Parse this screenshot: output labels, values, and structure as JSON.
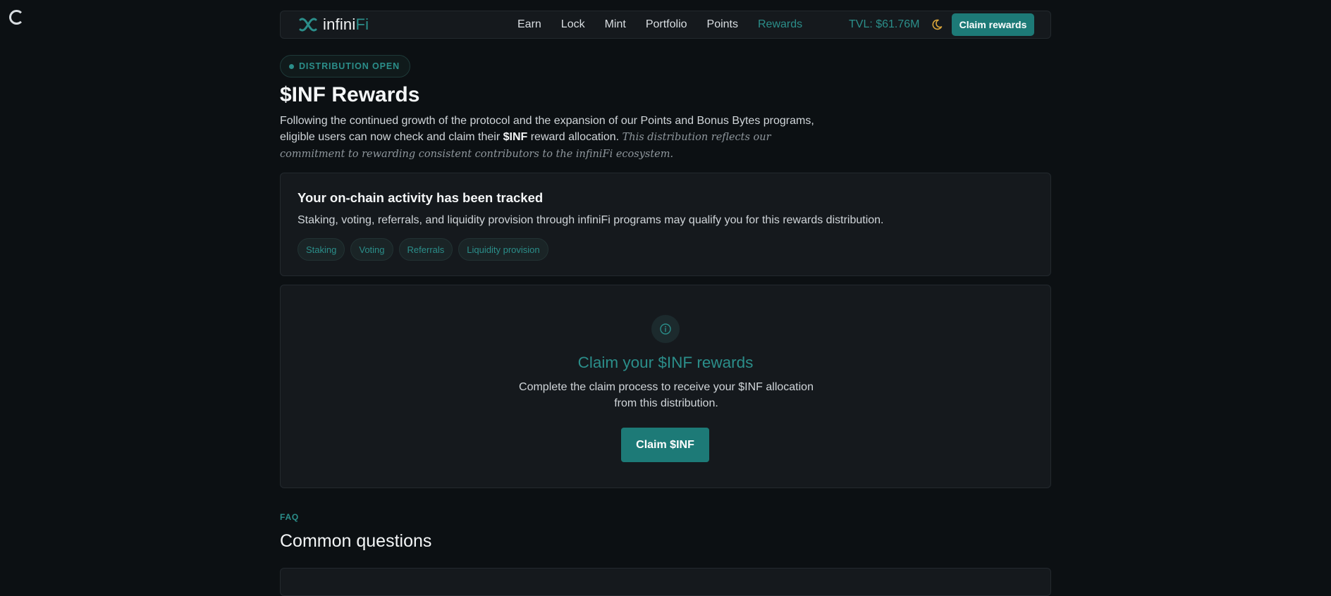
{
  "brand": {
    "name_main": "infini",
    "name_accent": "Fi",
    "accent_color": "#2b8e8a"
  },
  "nav": {
    "links": [
      "Earn",
      "Lock",
      "Mint",
      "Portfolio",
      "Points",
      "Rewards"
    ],
    "active": "Rewards",
    "tvl": "TVL: $61.76M",
    "theme_icon": "moon-icon",
    "claim_button": "Claim rewards"
  },
  "hero": {
    "badge": "DISTRIBUTION OPEN",
    "title": "$INF Rewards",
    "intro_part1": "Following the continued growth of the protocol and the expansion of our Points and Bonus Bytes programs, eligible users can now check and claim their ",
    "intro_bold": "$INF",
    "intro_part2": " reward allocation. ",
    "intro_italic": "This distribution reflects our commitment to rewarding consistent contributors to the infiniFi ecosystem."
  },
  "activity": {
    "title": "Your on-chain activity has been tracked",
    "description": "Staking, voting, referrals, and liquidity provision through infiniFi programs may qualify you for this rewards distribution.",
    "chips": [
      "Staking",
      "Voting",
      "Referrals",
      "Liquidity provision"
    ]
  },
  "claim": {
    "icon": "info-icon",
    "title": "Claim your $INF rewards",
    "description": "Complete the claim process to receive your $INF allocation from this distribution.",
    "button": "Claim $INF"
  },
  "faq": {
    "label": "FAQ",
    "title": "Common questions"
  }
}
